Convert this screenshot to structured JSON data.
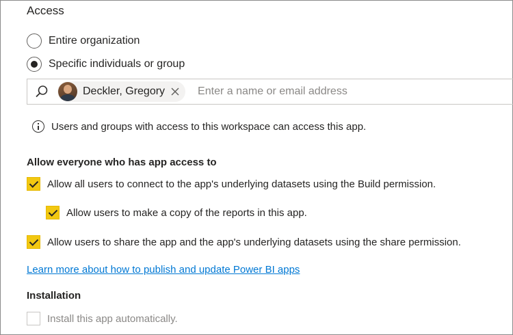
{
  "access": {
    "heading": "Access",
    "options": [
      {
        "label": "Entire organization",
        "selected": false
      },
      {
        "label": "Specific individuals or group",
        "selected": true
      }
    ],
    "people_picker": {
      "selected_person": "Deckler, Gregory",
      "placeholder": "Enter a name or email address"
    },
    "info_text": "Users and groups with access to this workspace can access this app."
  },
  "permissions": {
    "heading": "Allow everyone who has app access to",
    "build_label": "Allow all users to connect to the app's underlying datasets using the Build permission.",
    "copy_label": "Allow users to make a copy of the reports in this app.",
    "share_label": "Allow users to share the app and the app's underlying datasets using the share permission."
  },
  "learn_more_link": "Learn more about how to publish and update Power BI apps",
  "installation": {
    "heading": "Installation",
    "auto_install_label": "Install this app automatically."
  },
  "colors": {
    "checkbox_accent": "#f2c811",
    "link": "#0078d4"
  }
}
